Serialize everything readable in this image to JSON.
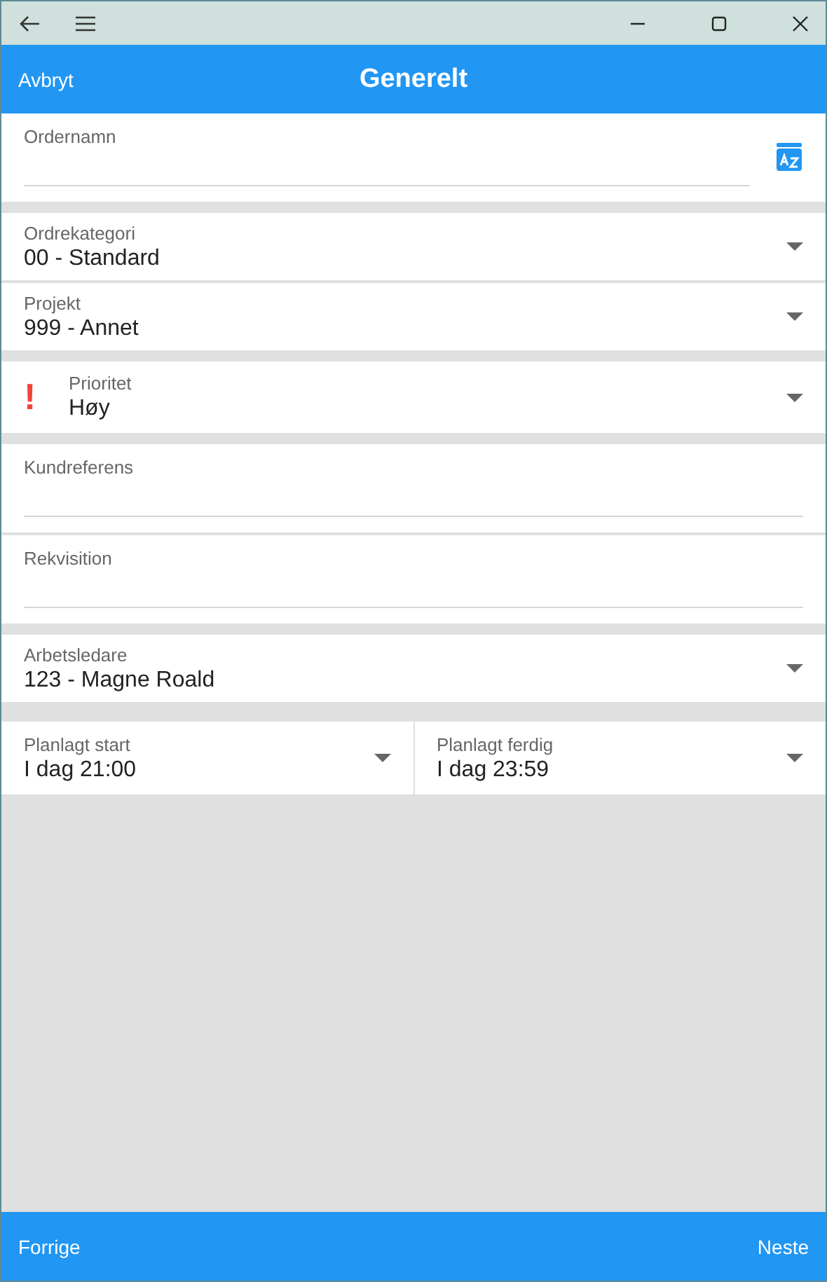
{
  "header": {
    "cancel": "Avbryt",
    "title": "Generelt"
  },
  "groups": [
    {
      "fields": [
        {
          "kind": "text",
          "label": "Ordernamn",
          "icon": true
        }
      ]
    },
    {
      "fields": [
        {
          "kind": "dropdown",
          "label": "Ordrekategori",
          "value": "00 - Standard"
        },
        {
          "kind": "dropdown",
          "label": "Projekt",
          "value": "999 - Annet"
        }
      ]
    },
    {
      "fields": [
        {
          "kind": "dropdown",
          "label": "Prioritet",
          "value": "Høy",
          "flag": "!"
        }
      ]
    },
    {
      "fields": [
        {
          "kind": "text",
          "label": "Kundreferens"
        },
        {
          "kind": "text",
          "label": "Rekvisition"
        }
      ]
    },
    {
      "fields": [
        {
          "kind": "dropdown",
          "label": "Arbetsledare",
          "value": "123 - Magne Roald"
        }
      ]
    },
    {
      "fields": [
        {
          "kind": "pair",
          "items": [
            {
              "label": "Planlagt start",
              "value": "I dag 21:00"
            },
            {
              "label": "Planlagt ferdig",
              "value": "I dag 23:59"
            }
          ]
        }
      ]
    }
  ],
  "footer": {
    "back": "Forrige",
    "next": "Neste"
  }
}
